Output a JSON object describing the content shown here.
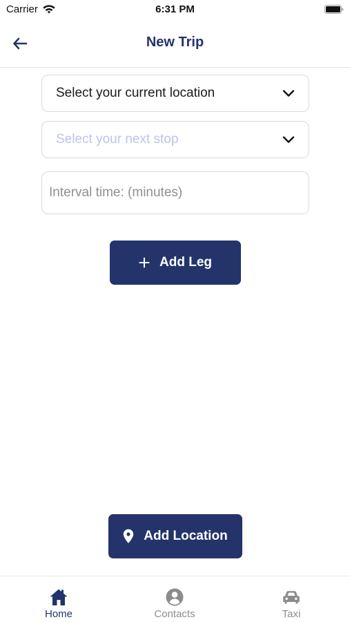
{
  "status_bar": {
    "carrier": "Carrier",
    "time": "6:31 PM"
  },
  "header": {
    "title": "New Trip",
    "back_icon": "arrow-left-icon"
  },
  "form": {
    "current_location": {
      "value": "Select your current location",
      "icon": "chevron-down-icon"
    },
    "next_stop": {
      "placeholder": "Select your next stop",
      "icon": "chevron-down-icon"
    },
    "interval_time": {
      "value": "",
      "placeholder": "Interval time: (minutes)"
    },
    "add_leg": {
      "label": "Add Leg",
      "icon": "plus-icon"
    }
  },
  "add_location": {
    "label": "Add Location",
    "icon": "map-pin-icon"
  },
  "tab_bar": {
    "tabs": [
      {
        "label": "Home",
        "icon": "home-icon",
        "active": true
      },
      {
        "label": "Contacts",
        "icon": "user-circle-icon",
        "active": false
      },
      {
        "label": "Taxi",
        "icon": "car-icon",
        "active": false
      }
    ]
  },
  "colors": {
    "primary": "#24346b",
    "placeholder_select": "#bfc2ea",
    "inactive_tab": "#8c8c8c",
    "border": "#d9d9d9"
  }
}
